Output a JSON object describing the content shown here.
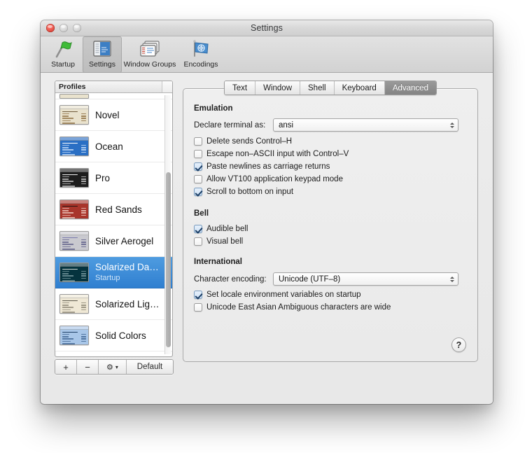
{
  "window": {
    "title": "Settings",
    "traffic_lights": [
      "close",
      "minimize",
      "zoom"
    ]
  },
  "toolbar": {
    "items": [
      {
        "id": "startup",
        "label": "Startup",
        "icon": "flag-icon",
        "selected": false
      },
      {
        "id": "settings",
        "label": "Settings",
        "icon": "settings-window-icon",
        "selected": true
      },
      {
        "id": "window-groups",
        "label": "Window Groups",
        "icon": "window-stack-icon",
        "selected": false
      },
      {
        "id": "encodings",
        "label": "Encodings",
        "icon": "un-flag-icon",
        "selected": false
      }
    ]
  },
  "profiles_panel": {
    "header": "Profiles",
    "items": [
      {
        "name": "Novel",
        "subtitle": "",
        "selected": false,
        "bg": "#e9e2cd",
        "fg": "#8a6a3b",
        "accent": "#6e5a3a"
      },
      {
        "name": "Ocean",
        "subtitle": "",
        "selected": false,
        "bg": "#2a6fc4",
        "fg": "#cfe3fb",
        "accent": "#ffffff"
      },
      {
        "name": "Pro",
        "subtitle": "",
        "selected": false,
        "bg": "#1d1d1d",
        "fg": "#cfcfcf",
        "accent": "#f2f2f2"
      },
      {
        "name": "Red Sands",
        "subtitle": "",
        "selected": false,
        "bg": "#a8352b",
        "fg": "#f0cfc6",
        "accent": "#2a1410"
      },
      {
        "name": "Silver Aerogel",
        "subtitle": "",
        "selected": false,
        "bg": "#c9c9cf",
        "fg": "#5a5a86",
        "accent": "#7a7aae"
      },
      {
        "name": "Solarized Da…",
        "subtitle": "Startup",
        "selected": true,
        "bg": "#05333e",
        "fg": "#7fa0a6",
        "accent": "#cfd8d4"
      },
      {
        "name": "Solarized Lig…",
        "subtitle": "",
        "selected": false,
        "bg": "#efe8d5",
        "fg": "#8a8371",
        "accent": "#5d594c"
      },
      {
        "name": "Solid Colors",
        "subtitle": "",
        "selected": false,
        "bg": "#a8c6e8",
        "fg": "#3a5f8d",
        "accent": "#1e4066"
      }
    ],
    "buttons": {
      "add": "+",
      "remove": "−",
      "gear": "⚙",
      "gear_chevron": "▾",
      "default": "Default"
    }
  },
  "tabs": [
    {
      "label": "Text",
      "active": false
    },
    {
      "label": "Window",
      "active": false
    },
    {
      "label": "Shell",
      "active": false
    },
    {
      "label": "Keyboard",
      "active": false
    },
    {
      "label": "Advanced",
      "active": true
    }
  ],
  "advanced": {
    "emulation": {
      "title": "Emulation",
      "declare_label": "Declare terminal as:",
      "declare_value": "ansi",
      "checkboxes": [
        {
          "label": "Delete sends Control–H",
          "checked": false
        },
        {
          "label": "Escape non–ASCII input with Control–V",
          "checked": false
        },
        {
          "label": "Paste newlines as carriage returns",
          "checked": true
        },
        {
          "label": "Allow VT100 application keypad mode",
          "checked": false
        },
        {
          "label": "Scroll to bottom on input",
          "checked": true
        }
      ]
    },
    "bell": {
      "title": "Bell",
      "checkboxes": [
        {
          "label": "Audible bell",
          "checked": true
        },
        {
          "label": "Visual bell",
          "checked": false
        }
      ]
    },
    "international": {
      "title": "International",
      "encoding_label": "Character encoding:",
      "encoding_value": "Unicode (UTF–8)",
      "checkboxes": [
        {
          "label": "Set locale environment variables on startup",
          "checked": true
        },
        {
          "label": "Unicode East Asian Ambiguous characters are wide",
          "checked": false
        }
      ]
    },
    "help_button": "?"
  },
  "colors": {
    "selection_blue": "#3b87d8",
    "active_tab_gray": "#8f8f8f",
    "window_bg": "#ececec"
  }
}
